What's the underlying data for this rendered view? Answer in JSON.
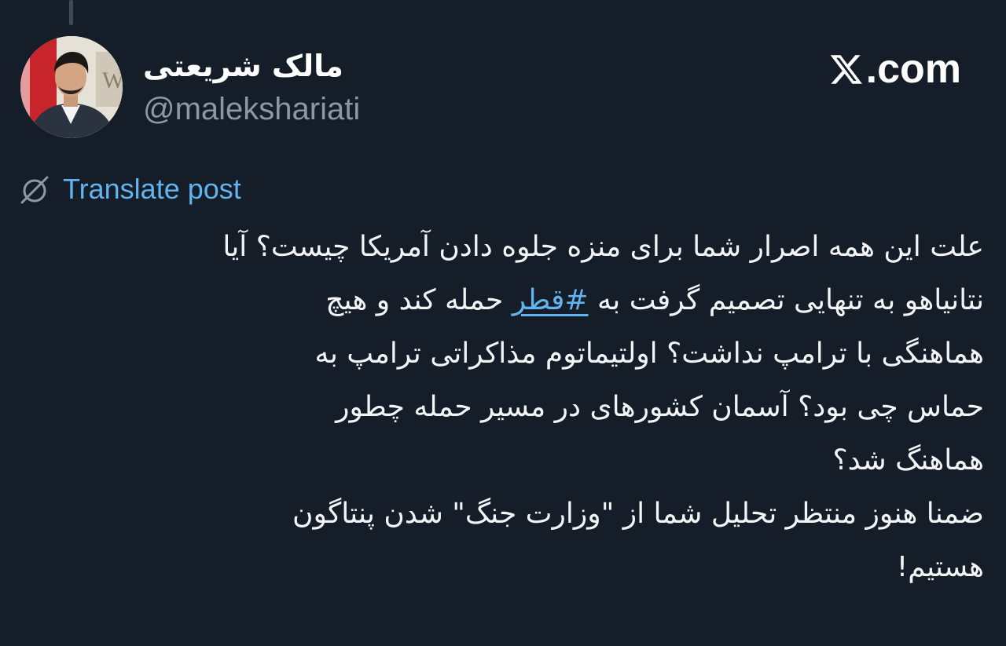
{
  "author": {
    "display_name": "مالک شریعتی",
    "handle": "@malekshariati",
    "avatar_icon": "profile-photo"
  },
  "brand": {
    "icon": "x-logo-icon",
    "domain": ".com"
  },
  "translate": {
    "icon": "globe-icon",
    "label": "Translate post"
  },
  "post": {
    "line1": "علت این همه اصرار شما برای منزه جلوه دادن آمریکا چیست؟ آیا",
    "line2_before": "نتانیاهو به تنهایی تصمیم گرفت به ",
    "hashtag": "#قطر",
    "line2_after": " حمله کند و هیچ",
    "line3": "هماهنگی با ترامپ نداشت؟ اولتیماتوم مذاکراتی ترامپ به",
    "line4": "حماس چی بود؟ آسمان کشورهای در مسیر حمله چطور",
    "line5": "هماهنگ شد؟",
    "line6": "ضمنا هنوز منتظر تحلیل شما از \"وزارت جنگ\" شدن پنتاگون",
    "line7": "هستیم!"
  },
  "colors": {
    "background": "#151d29",
    "link": "#62b4ee",
    "secondary_text": "#8b98a5"
  }
}
